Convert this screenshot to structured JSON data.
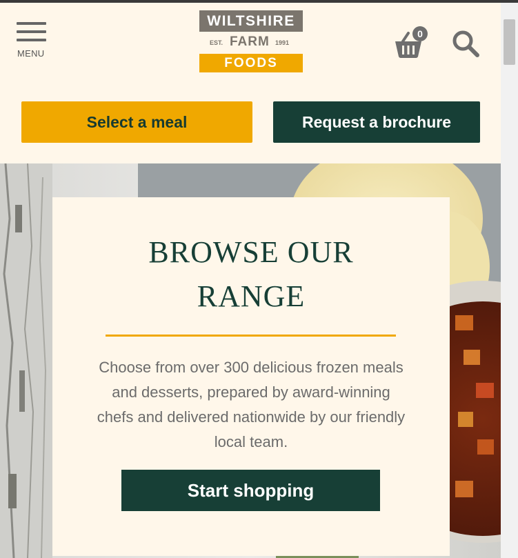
{
  "header": {
    "menu_label": "MENU",
    "logo": {
      "top": "WILTSHIRE",
      "est": "EST.",
      "middle": "FARM",
      "year": "1991",
      "bottom": "FOODS"
    },
    "basket_count": "0"
  },
  "actions": {
    "select_meal": "Select a meal",
    "request_brochure": "Request a brochure"
  },
  "hero": {
    "title_line1": "BROWSE OUR",
    "title_line2": "RANGE",
    "description": "Choose from over 300 delicious frozen meals and desserts, prepared by award-winning chefs and delivered nationwide by our friendly local team.",
    "cta": "Start shopping"
  },
  "colors": {
    "brand_yellow": "#f0a800",
    "brand_green": "#173f36",
    "cream": "#fff7ea",
    "logo_grey": "#7b756d"
  },
  "icons": [
    "hamburger-menu-icon",
    "basket-icon",
    "search-icon"
  ]
}
